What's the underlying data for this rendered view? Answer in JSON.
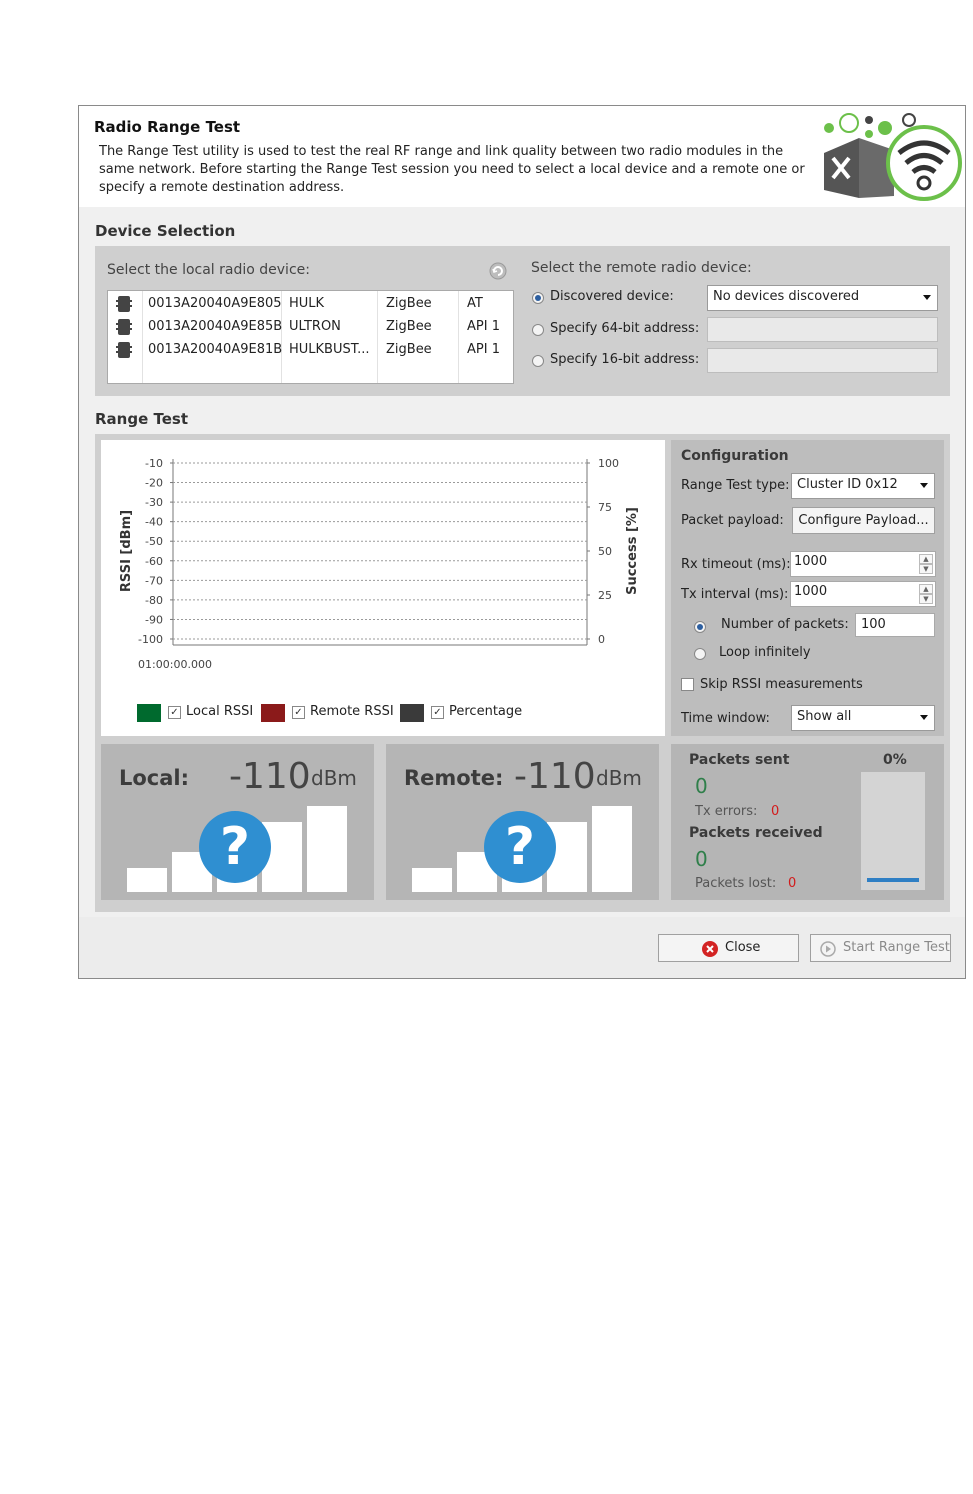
{
  "dialog": {
    "title": "Radio Range Test",
    "description": "The Range Test utility is used to test the real RF range and link quality between two radio modules in the same network. Before starting the Range Test session you need to select a local device and a remote one or specify a remote destination address."
  },
  "device_selection": {
    "title": "Device Selection",
    "local_label": "Select the local radio device:",
    "local_devices": [
      {
        "address": "0013A20040A9E805",
        "name": "HULK",
        "protocol": "ZigBee",
        "mode": "AT"
      },
      {
        "address": "0013A20040A9E85B",
        "name": "ULTRON",
        "protocol": "ZigBee",
        "mode": "API 1"
      },
      {
        "address": "0013A20040A9E81B",
        "name": "HULKBUST...",
        "protocol": "ZigBee",
        "mode": "API 1"
      }
    ],
    "remote_label": "Select the remote radio device:",
    "remote_options": [
      {
        "label": "Discovered device:",
        "selected": true
      },
      {
        "label": "Specify 64-bit address:",
        "selected": false
      },
      {
        "label": "Specify 16-bit address:",
        "selected": false
      }
    ],
    "discovered_value": "No devices discovered"
  },
  "range_test": {
    "title": "Range Test",
    "legend": [
      {
        "label": "Local RSSI",
        "color": "#006a2e",
        "checked": true
      },
      {
        "label": "Remote RSSI",
        "color": "#8b1a1a",
        "checked": true
      },
      {
        "label": "Percentage",
        "color": "#3a3a3a",
        "checked": true
      }
    ]
  },
  "chart_data": {
    "type": "line",
    "ylabel": "RSSI [dBm]",
    "y2label": "Success [%]",
    "ylim": [
      -100,
      -10
    ],
    "y2lim": [
      0,
      100
    ],
    "y_ticks": [
      "-10",
      "-20",
      "-30",
      "-40",
      "-50",
      "-60",
      "-70",
      "-80",
      "-90",
      "-100"
    ],
    "y2_ticks": [
      "100",
      "75",
      "50",
      "25",
      "0"
    ],
    "x_ticks": [
      "01:00:00.000"
    ],
    "grid": true,
    "series": []
  },
  "configuration": {
    "title": "Configuration",
    "range_test_type_label": "Range Test type:",
    "range_test_type_value": "Cluster ID 0x12",
    "packet_payload_label": "Packet payload:",
    "configure_payload_button": "Configure Payload...",
    "rx_timeout_label": "Rx timeout (ms):",
    "rx_timeout_value": "1000",
    "tx_interval_label": "Tx interval (ms):",
    "tx_interval_value": "1000",
    "number_of_packets_label": "Number of packets:",
    "number_of_packets_value": "100",
    "number_of_packets_selected": true,
    "loop_label": "Loop infinitely",
    "loop_selected": false,
    "skip_rssi_label": "Skip RSSI measurements",
    "skip_rssi_checked": false,
    "time_window_label": "Time window:",
    "time_window_value": "Show all"
  },
  "local_panel": {
    "label": "Local:",
    "value": "-110",
    "unit": "dBm",
    "status_icon": "question-mark-icon"
  },
  "remote_panel": {
    "label": "Remote:",
    "value": "-110",
    "unit": "dBm",
    "status_icon": "question-mark-icon"
  },
  "stats": {
    "packets_sent_label": "Packets sent",
    "packets_sent_value": "0",
    "tx_errors_label": "Tx errors:",
    "tx_errors_value": "0",
    "packets_received_label": "Packets received",
    "packets_received_value": "0",
    "packets_lost_label": "Packets lost:",
    "packets_lost_value": "0",
    "percentage_label": "0%",
    "percentage_value": 0
  },
  "buttons": {
    "close": "Close",
    "start": "Start Range Test"
  },
  "icons": {
    "app_logo": "xctu-tools-wifi-icon",
    "device": "radio-module-icon",
    "refresh": "refresh-icon",
    "close": "close-circle-icon",
    "start": "play-circle-icon"
  }
}
